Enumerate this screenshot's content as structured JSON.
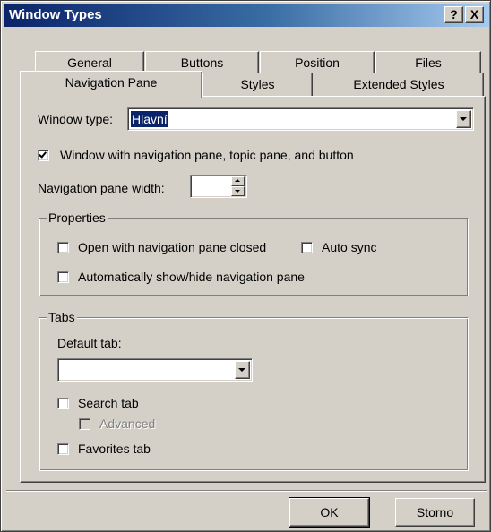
{
  "window": {
    "title": "Window Types",
    "help_button": "?",
    "close_button": "X"
  },
  "tabs": {
    "row_back": [
      "General",
      "Buttons",
      "Position",
      "Files"
    ],
    "row_front": [
      "Navigation Pane",
      "Styles",
      "Extended Styles"
    ],
    "active": "Navigation Pane"
  },
  "navigation_pane": {
    "window_type_label": "Window type:",
    "window_type_value": "Hlavní",
    "nav_checkbox_label": "Window with navigation pane, topic pane, and button",
    "nav_checkbox_checked": true,
    "pane_width_label": "Navigation pane width:",
    "pane_width_value": "",
    "properties": {
      "legend": "Properties",
      "open_closed_label": "Open with navigation pane closed",
      "open_closed_checked": false,
      "auto_sync_label": "Auto sync",
      "auto_sync_checked": false,
      "auto_show_hide_label": "Automatically show/hide navigation pane",
      "auto_show_hide_checked": false
    },
    "tabs_group": {
      "legend": "Tabs",
      "default_tab_label": "Default tab:",
      "default_tab_value": "",
      "search_tab_label": "Search tab",
      "search_tab_checked": false,
      "advanced_label": "Advanced",
      "advanced_checked": false,
      "advanced_enabled": false,
      "favorites_tab_label": "Favorites tab",
      "favorites_tab_checked": false
    }
  },
  "footer": {
    "ok_label": "OK",
    "cancel_label": "Storno"
  }
}
